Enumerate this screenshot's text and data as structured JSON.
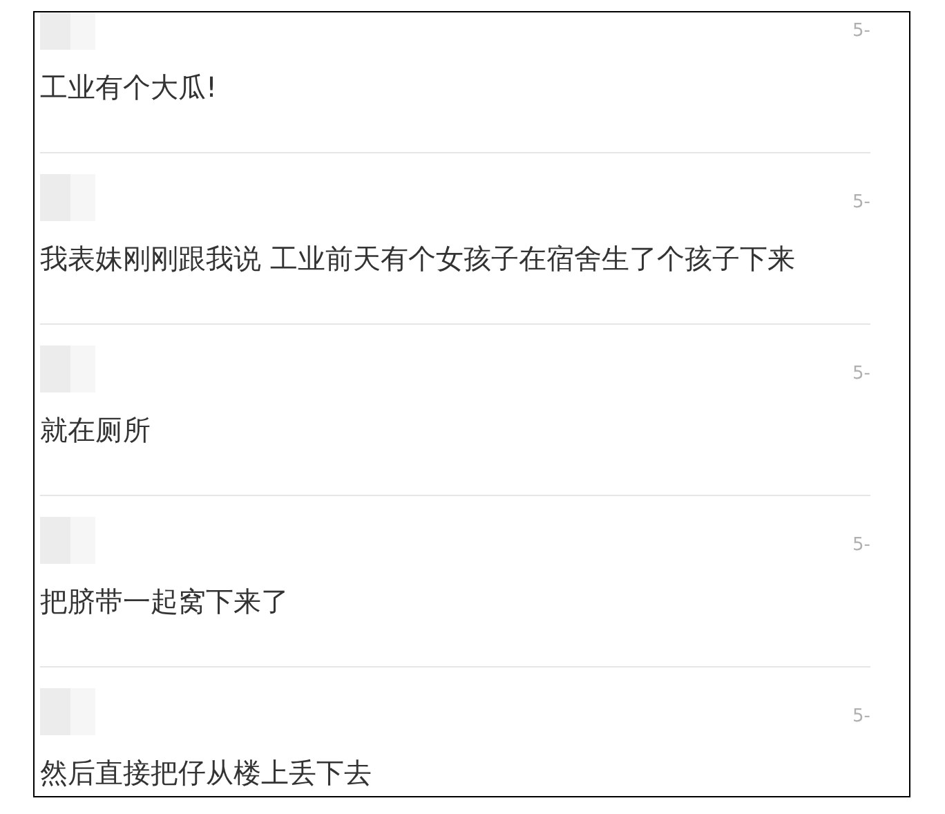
{
  "messages": [
    {
      "date": "5-",
      "text": "工业有个大瓜!"
    },
    {
      "date": "5-",
      "text": "我表妹刚刚跟我说 工业前天有个女孩子在宿舍生了个孩子下来"
    },
    {
      "date": "5-",
      "text": "就在厕所"
    },
    {
      "date": "5-",
      "text": "把脐带一起窝下来了"
    },
    {
      "date": "5-",
      "text": "然后直接把仔从楼上丢下去"
    }
  ]
}
